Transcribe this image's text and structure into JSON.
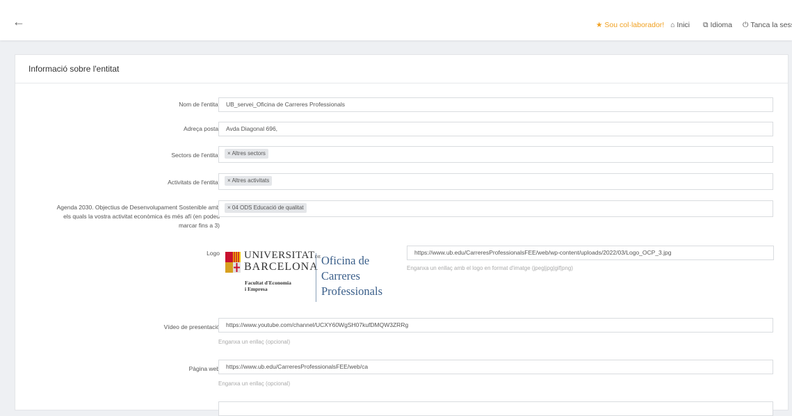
{
  "topbar": {
    "back_icon": "arrow-left-icon",
    "collaborator": "Sou col·laborador!",
    "inici": "Inici",
    "idioma": "Idioma",
    "tanca": "Tanca la sessi",
    "accent_color": "#f0a020"
  },
  "card": {
    "title": "Informació sobre l'entitat"
  },
  "form": {
    "nom": {
      "label": "Nom de l'entitat",
      "value": "UB_servei_Oficina de Carreres Professionals"
    },
    "adreca": {
      "label": "Adreça postal",
      "value": "Avda Diagonal 696,"
    },
    "sectors": {
      "label": "Sectors de l'entitat",
      "tag": "× Altres sectors"
    },
    "activitats": {
      "label": "Activitats de l'entitat",
      "tag": "× Altres activitats"
    },
    "agenda": {
      "label_line1": "Agenda 2030. Objectius de Desenvolupament Sostenible amb",
      "label_line2": "els quals la vostra activitat econòmica és més afí (en podeu",
      "label_line3": "marcar fins a 3)",
      "tag": "× 04 ODS Educació de qualitat"
    },
    "logo": {
      "label": "Logo",
      "value": "https://www.ub.edu/CarreresProfessionalsFEE/web/wp-content/uploads/2022/03/Logo_OCP_3.jpg",
      "help": "Enganxa un enllaç amb el logo en format d'imatge (jpeg|jpg|gif|png)",
      "image": {
        "uni_line1": "UNIVERSITAT",
        "uni_de": "DE",
        "uni_line2": "BARCELONA",
        "fac_line1": "Facultat d'Economia",
        "fac_line2": "i Empresa",
        "ocp_line1": "Oficina de",
        "ocp_line2": "Carreres",
        "ocp_line3": "Professionals"
      }
    },
    "video": {
      "label": "Vídeo de presentació",
      "value": "https://www.youtube.com/channel/UCXY60WgSH07kufDMQW3ZRRg",
      "help": "Enganxa un enllaç (opcional)"
    },
    "web": {
      "label": "Pàgina web",
      "value": "https://www.ub.edu/CarreresProfessionalsFEE/web/ca",
      "help": "Enganxa un enllaç (opcional)"
    }
  }
}
